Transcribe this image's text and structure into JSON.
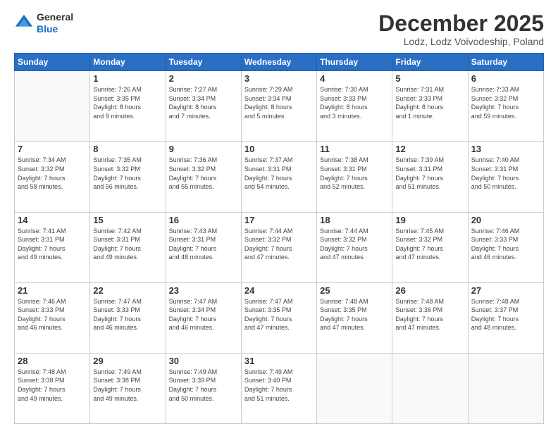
{
  "header": {
    "logo_line1": "General",
    "logo_line2": "Blue",
    "month_title": "December 2025",
    "location": "Lodz, Lodz Voivodeship, Poland"
  },
  "weekdays": [
    "Sunday",
    "Monday",
    "Tuesday",
    "Wednesday",
    "Thursday",
    "Friday",
    "Saturday"
  ],
  "weeks": [
    [
      {
        "day": "",
        "info": ""
      },
      {
        "day": "1",
        "info": "Sunrise: 7:26 AM\nSunset: 3:35 PM\nDaylight: 8 hours\nand 9 minutes."
      },
      {
        "day": "2",
        "info": "Sunrise: 7:27 AM\nSunset: 3:34 PM\nDaylight: 8 hours\nand 7 minutes."
      },
      {
        "day": "3",
        "info": "Sunrise: 7:29 AM\nSunset: 3:34 PM\nDaylight: 8 hours\nand 5 minutes."
      },
      {
        "day": "4",
        "info": "Sunrise: 7:30 AM\nSunset: 3:33 PM\nDaylight: 8 hours\nand 3 minutes."
      },
      {
        "day": "5",
        "info": "Sunrise: 7:31 AM\nSunset: 3:33 PM\nDaylight: 8 hours\nand 1 minute."
      },
      {
        "day": "6",
        "info": "Sunrise: 7:33 AM\nSunset: 3:32 PM\nDaylight: 7 hours\nand 59 minutes."
      }
    ],
    [
      {
        "day": "7",
        "info": "Sunrise: 7:34 AM\nSunset: 3:32 PM\nDaylight: 7 hours\nand 58 minutes."
      },
      {
        "day": "8",
        "info": "Sunrise: 7:35 AM\nSunset: 3:32 PM\nDaylight: 7 hours\nand 56 minutes."
      },
      {
        "day": "9",
        "info": "Sunrise: 7:36 AM\nSunset: 3:32 PM\nDaylight: 7 hours\nand 55 minutes."
      },
      {
        "day": "10",
        "info": "Sunrise: 7:37 AM\nSunset: 3:31 PM\nDaylight: 7 hours\nand 54 minutes."
      },
      {
        "day": "11",
        "info": "Sunrise: 7:38 AM\nSunset: 3:31 PM\nDaylight: 7 hours\nand 52 minutes."
      },
      {
        "day": "12",
        "info": "Sunrise: 7:39 AM\nSunset: 3:31 PM\nDaylight: 7 hours\nand 51 minutes."
      },
      {
        "day": "13",
        "info": "Sunrise: 7:40 AM\nSunset: 3:31 PM\nDaylight: 7 hours\nand 50 minutes."
      }
    ],
    [
      {
        "day": "14",
        "info": "Sunrise: 7:41 AM\nSunset: 3:31 PM\nDaylight: 7 hours\nand 49 minutes."
      },
      {
        "day": "15",
        "info": "Sunrise: 7:42 AM\nSunset: 3:31 PM\nDaylight: 7 hours\nand 49 minutes."
      },
      {
        "day": "16",
        "info": "Sunrise: 7:43 AM\nSunset: 3:31 PM\nDaylight: 7 hours\nand 48 minutes."
      },
      {
        "day": "17",
        "info": "Sunrise: 7:44 AM\nSunset: 3:32 PM\nDaylight: 7 hours\nand 47 minutes."
      },
      {
        "day": "18",
        "info": "Sunrise: 7:44 AM\nSunset: 3:32 PM\nDaylight: 7 hours\nand 47 minutes."
      },
      {
        "day": "19",
        "info": "Sunrise: 7:45 AM\nSunset: 3:32 PM\nDaylight: 7 hours\nand 47 minutes."
      },
      {
        "day": "20",
        "info": "Sunrise: 7:46 AM\nSunset: 3:33 PM\nDaylight: 7 hours\nand 46 minutes."
      }
    ],
    [
      {
        "day": "21",
        "info": "Sunrise: 7:46 AM\nSunset: 3:33 PM\nDaylight: 7 hours\nand 46 minutes."
      },
      {
        "day": "22",
        "info": "Sunrise: 7:47 AM\nSunset: 3:33 PM\nDaylight: 7 hours\nand 46 minutes."
      },
      {
        "day": "23",
        "info": "Sunrise: 7:47 AM\nSunset: 3:34 PM\nDaylight: 7 hours\nand 46 minutes."
      },
      {
        "day": "24",
        "info": "Sunrise: 7:47 AM\nSunset: 3:35 PM\nDaylight: 7 hours\nand 47 minutes."
      },
      {
        "day": "25",
        "info": "Sunrise: 7:48 AM\nSunset: 3:35 PM\nDaylight: 7 hours\nand 47 minutes."
      },
      {
        "day": "26",
        "info": "Sunrise: 7:48 AM\nSunset: 3:36 PM\nDaylight: 7 hours\nand 47 minutes."
      },
      {
        "day": "27",
        "info": "Sunrise: 7:48 AM\nSunset: 3:37 PM\nDaylight: 7 hours\nand 48 minutes."
      }
    ],
    [
      {
        "day": "28",
        "info": "Sunrise: 7:48 AM\nSunset: 3:38 PM\nDaylight: 7 hours\nand 49 minutes."
      },
      {
        "day": "29",
        "info": "Sunrise: 7:49 AM\nSunset: 3:38 PM\nDaylight: 7 hours\nand 49 minutes."
      },
      {
        "day": "30",
        "info": "Sunrise: 7:49 AM\nSunset: 3:39 PM\nDaylight: 7 hours\nand 50 minutes."
      },
      {
        "day": "31",
        "info": "Sunrise: 7:49 AM\nSunset: 3:40 PM\nDaylight: 7 hours\nand 51 minutes."
      },
      {
        "day": "",
        "info": ""
      },
      {
        "day": "",
        "info": ""
      },
      {
        "day": "",
        "info": ""
      }
    ]
  ]
}
